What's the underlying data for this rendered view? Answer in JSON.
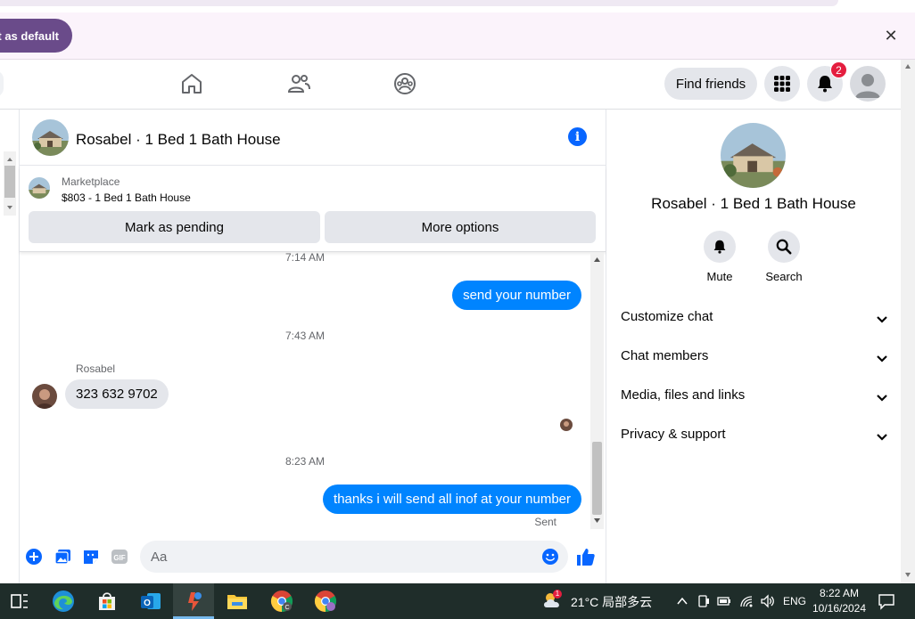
{
  "banner": {
    "button_label": "t as default",
    "close_icon": "close-icon"
  },
  "nav": {
    "find_friends": "Find friends",
    "notification_count": "2",
    "icons": [
      "home-icon",
      "friends-icon",
      "groups-icon",
      "menu-grid-icon",
      "bell-icon",
      "account-avatar"
    ]
  },
  "chat": {
    "title": "Rosabel · 1 Bed 1 Bath House",
    "marketplace_label": "Marketplace",
    "listing": "$803 - 1 Bed 1 Bath House",
    "mark_pending": "Mark as pending",
    "more_options": "More options",
    "messages": [
      {
        "type": "time",
        "text": "7:14 AM"
      },
      {
        "type": "out",
        "text": "send your number"
      },
      {
        "type": "time",
        "text": "7:43 AM"
      },
      {
        "type": "in",
        "sender": "Rosabel",
        "text": "323 632 9702"
      },
      {
        "type": "time",
        "text": "8:23 AM"
      },
      {
        "type": "out",
        "text": "thanks i will send all inof at your number"
      }
    ],
    "sent_status": "Sent",
    "composer_placeholder": "Aa"
  },
  "info_panel": {
    "title": "Rosabel · 1 Bed 1 Bath House",
    "mute": "Mute",
    "search": "Search",
    "sections": [
      "Customize chat",
      "Chat members",
      "Media, files and links",
      "Privacy & support"
    ]
  },
  "taskbar": {
    "weather_badge": "1",
    "weather": "21°C  局部多云",
    "language": "ENG",
    "time": "8:22 AM",
    "date": "10/16/2024"
  },
  "colors": {
    "accent": "#0866ff",
    "bubble_out": "#0084ff",
    "badge": "#e41e3f",
    "banner_button": "#6a4b8a"
  }
}
